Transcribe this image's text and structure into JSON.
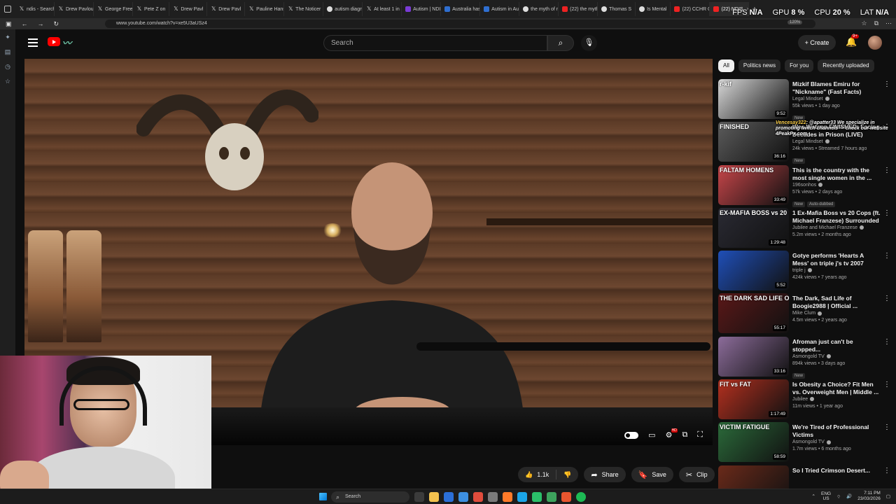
{
  "browser": {
    "tabs": [
      {
        "icon": "x-icon",
        "label": "ndis - Search"
      },
      {
        "icon": "x-icon",
        "label": "Drew Pavlou"
      },
      {
        "icon": "x-icon",
        "label": "George Free"
      },
      {
        "icon": "x-icon",
        "label": "Pete Z on"
      },
      {
        "icon": "x-icon",
        "label": "Drew Pavl"
      },
      {
        "icon": "x-icon",
        "label": "Drew Pavl"
      },
      {
        "icon": "x-icon",
        "label": "Pauline Hans"
      },
      {
        "icon": "x-icon",
        "label": "The Noticer"
      },
      {
        "icon": "globe-icon",
        "label": "autism diagn"
      },
      {
        "icon": "x-icon",
        "label": "At least 1 in 4"
      },
      {
        "icon": "autism-icon",
        "label": "Autism | NDIS"
      },
      {
        "icon": "abc-icon",
        "label": "Australia has"
      },
      {
        "icon": "abc-icon",
        "label": "Autism in Aus"
      },
      {
        "icon": "globe-icon",
        "label": "the myth of m"
      },
      {
        "icon": "youtube-icon",
        "label": "(22) the myth"
      },
      {
        "icon": "globe-icon",
        "label": "Thomas S"
      },
      {
        "icon": "globe-icon",
        "label": "Is Mental"
      },
      {
        "icon": "youtube-icon",
        "label": "(22) CCHR Co"
      },
      {
        "icon": "youtube-icon",
        "label": "(22) NDIS"
      }
    ],
    "active_tab_index": 18,
    "address": "www.youtube.com/watch?v=xe5U3aUSz4",
    "zoom": "120%"
  },
  "perf_overlay": {
    "fps_label": "FPS",
    "fps_value": "N/A",
    "gpu_label": "GPU",
    "gpu_value": "8 %",
    "cpu_label": "CPU",
    "cpu_value": "20 %",
    "lat_label": "LAT",
    "lat_value": "N/A"
  },
  "youtube": {
    "search_placeholder": "Search",
    "create_label": "Create",
    "notifications_badge": "9+",
    "player": {
      "controls": [
        "autoplay-toggle",
        "subtitles",
        "settings",
        "miniplayer",
        "fullscreen"
      ],
      "settings_badge": "HD"
    },
    "actions": {
      "like_count": "1.1k",
      "share": "Share",
      "save": "Save",
      "clip": "Clip"
    },
    "chips": [
      "All",
      "Politics news",
      "For you",
      "Recently uploaded"
    ],
    "active_chip": 0,
    "recommendations": [
      {
        "title": "Mizkif Blames Emiru for \"Nickname\" (Fast Facts)",
        "channel": "Legal Mindset",
        "stats": "55k views • 1 day ago",
        "badge": "New",
        "duration": "9:52",
        "thumb_text": "r-kif",
        "thumb_color": "#d8d8d8"
      },
      {
        "title": "Wes Watson FINISHED: Facing Decades in Prison (LIVE)",
        "channel": "Legal Mindset",
        "stats": "24k views • Streamed 7 hours ago",
        "badge": "New",
        "duration": "36:16",
        "thumb_text": "FINISHED",
        "thumb_color": "#5c5c5c"
      },
      {
        "title": "This is the country with the most single women in the ...",
        "channel": "196sonhos",
        "stats": "57k views • 2 days ago",
        "badge": "New",
        "badge2": "Auto-dubbed",
        "duration": "33:49",
        "thumb_text": "FALTAM HOMENS",
        "thumb_color": "#c8464a"
      },
      {
        "title": "1 Ex-Mafia Boss vs 20 Cops (ft. Michael Franzese) Surrounded",
        "channel": "Jubilee and Michael Franzese",
        "stats": "5.2m views • 2 months ago",
        "duration": "1:29:48",
        "thumb_text": "EX-MAFIA BOSS vs 20 COPS",
        "thumb_color": "#2a2a33"
      },
      {
        "title": "Gotye performs 'Hearts A Mess' on triple j's tv 2007",
        "channel": "triple j",
        "stats": "424k views • 7 years ago",
        "duration": "5:52",
        "thumb_text": "",
        "thumb_color": "#1f4fb8"
      },
      {
        "title": "The Dark, Sad Life of Boogie2988 | Official ...",
        "channel": "Mike Clum",
        "stats": "4.5m views • 2 years ago",
        "duration": "55:17",
        "thumb_text": "THE DARK SAD LIFE OF",
        "thumb_color": "#5a1818"
      },
      {
        "title": "Afroman just can't be stopped...",
        "channel": "Asmongold TV",
        "stats": "894k views • 3 days ago",
        "badge": "New",
        "duration": "33:16",
        "thumb_text": "",
        "thumb_color": "#8c6c9a"
      },
      {
        "title": "Is Obesity a Choice? Fit Men vs. Overweight Men | Middle ...",
        "channel": "Jubilee",
        "stats": "11m views • 1 year ago",
        "duration": "1:17:49",
        "thumb_text": "FIT vs FAT",
        "thumb_color": "#b4301f"
      },
      {
        "title": "We're Tired of Professional Victims",
        "channel": "Asmongold TV",
        "stats": "1.7m views • 6 months ago",
        "duration": "58:59",
        "thumb_text": "VICTIM FATIGUE",
        "thumb_color": "#2b6a3a"
      },
      {
        "title": "So I Tried Crimson Desert...",
        "channel": "",
        "stats": "",
        "duration": "",
        "thumb_text": "",
        "thumb_color": "#6a2a1a"
      }
    ]
  },
  "chat_overlay": {
    "user": "Vencesay322",
    "message": "@apatter33 We specialize in promoting twitch channels — check our website 4PeakPx.com"
  },
  "taskbar": {
    "search_placeholder": "Search",
    "lang_top": "ENG",
    "lang_bottom": "US",
    "time": "7:11 PM",
    "date": "23/03/2026"
  }
}
